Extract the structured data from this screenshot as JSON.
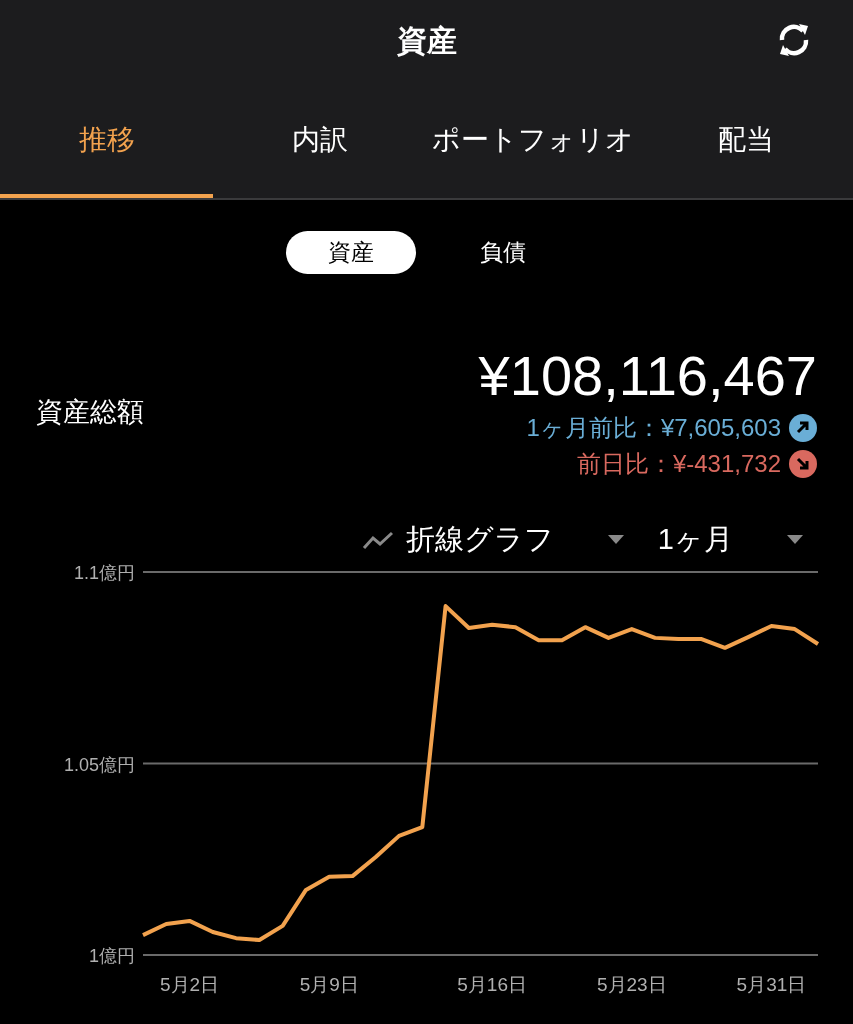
{
  "header": {
    "title": "資産"
  },
  "tabs": [
    {
      "label": "推移",
      "selected": true
    },
    {
      "label": "内訳",
      "selected": false
    },
    {
      "label": "ポートフォリオ",
      "selected": false
    },
    {
      "label": "配当",
      "selected": false
    }
  ],
  "segments": [
    {
      "label": "資産",
      "selected": true
    },
    {
      "label": "負債",
      "selected": false
    }
  ],
  "summary": {
    "label": "資産総額",
    "amount": "¥108,116,467",
    "changes": [
      {
        "kind": "up",
        "text": "1ヶ月前比：¥7,605,603",
        "color": "#6aaed6"
      },
      {
        "kind": "down",
        "text": "前日比：¥-431,732",
        "color": "#d9695f"
      }
    ]
  },
  "controls": {
    "chart_type": "折線グラフ",
    "period": "1ヶ月"
  },
  "chart_data": {
    "type": "line",
    "categories": [
      null,
      null,
      "5月2日",
      null,
      null,
      null,
      null,
      null,
      "5月9日",
      null,
      null,
      null,
      null,
      null,
      null,
      "5月16日",
      null,
      null,
      null,
      null,
      null,
      "5月23日",
      null,
      null,
      null,
      null,
      null,
      "5月31日",
      null,
      null
    ],
    "ylim": [
      1.0,
      1.1
    ],
    "yticks": [
      {
        "value": 1.0,
        "label": "1億円"
      },
      {
        "value": 1.05,
        "label": "1.05億円"
      },
      {
        "value": 1.1,
        "label": "1.1億円"
      }
    ],
    "series": [
      {
        "color": "#f2a24e",
        "values": [
          1.0052,
          1.0081,
          1.0089,
          1.006,
          1.0044,
          1.0039,
          1.0076,
          1.017,
          1.0204,
          1.0206,
          1.0256,
          1.0311,
          1.0334,
          1.0911,
          1.0854,
          1.0862,
          1.0856,
          1.0822,
          1.0822,
          1.0856,
          1.0828,
          1.0851,
          1.0828,
          1.0825,
          1.0825,
          1.0802,
          1.083,
          1.0859,
          1.0851,
          1.0812
        ]
      }
    ]
  }
}
